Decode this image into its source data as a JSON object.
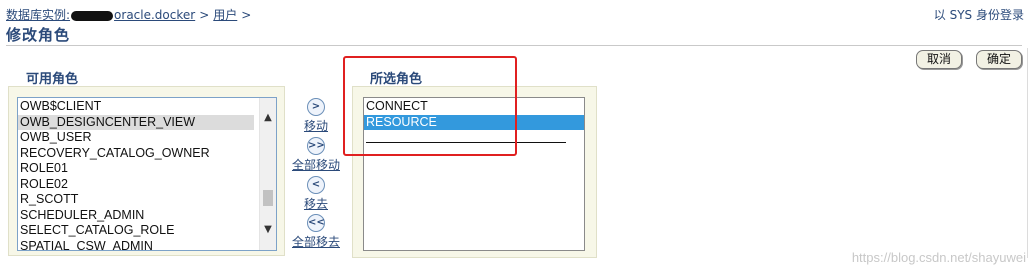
{
  "breadcrumb": {
    "instance_prefix": "数据库实例:",
    "instance_host": "oracle.docker",
    "separator": ">",
    "users": "用户",
    "trailing": ">"
  },
  "login_info": "以 SYS 身份登录",
  "page_title": "修改角色",
  "buttons": {
    "cancel": "取消",
    "ok": "确定"
  },
  "available": {
    "label": "可用角色",
    "items": [
      "OWB$CLIENT",
      "OWB_DESIGNCENTER_VIEW",
      "OWB_USER",
      "RECOVERY_CATALOG_OWNER",
      "ROLE01",
      "ROLE02",
      "R_SCOTT",
      "SCHEDULER_ADMIN",
      "SELECT_CATALOG_ROLE",
      "SPATIAL_CSW_ADMIN"
    ],
    "highlighted": "OWB_DESIGNCENTER_VIEW"
  },
  "selected": {
    "label": "所选角色",
    "items": [
      "CONNECT",
      "RESOURCE"
    ],
    "highlighted": "RESOURCE"
  },
  "movers": {
    "move": "移动",
    "move_all": "全部移动",
    "remove": "移去",
    "remove_all": "全部移去"
  },
  "icons": {
    "move": "single-right-arrow-icon",
    "move_all": "double-right-arrow-icon",
    "remove": "single-left-arrow-icon",
    "remove_all": "double-left-arrow-icon"
  },
  "annotation_color": "#e02020",
  "watermark": "https://blog.csdn.net/shayuwei"
}
